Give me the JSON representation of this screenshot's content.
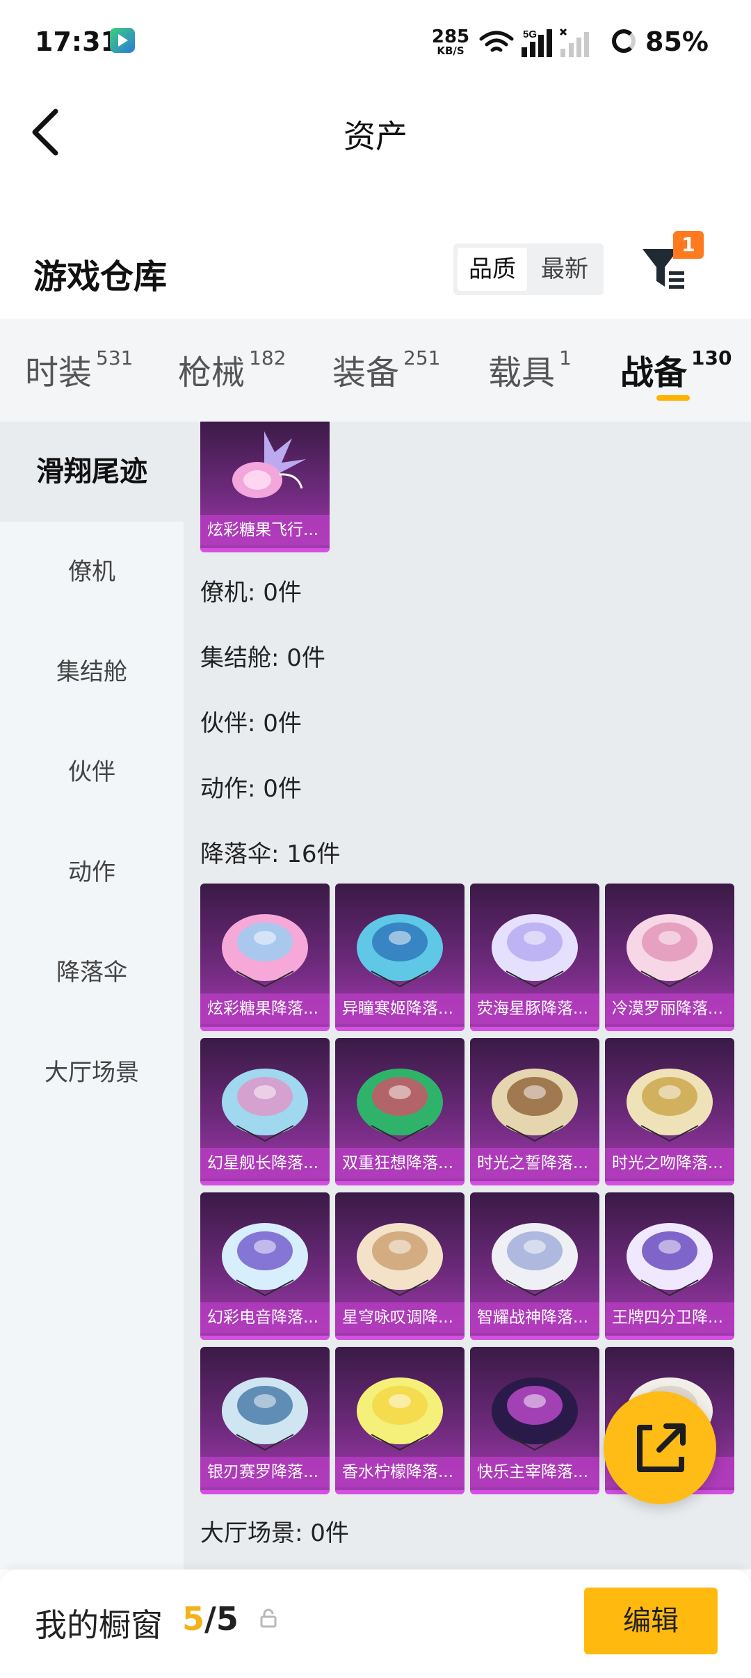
{
  "status_bar": {
    "time": "17:31",
    "net_speed": "285",
    "net_unit": "KB/S",
    "network_type": "5G",
    "battery": "85%"
  },
  "header": {
    "title": "资产"
  },
  "warehouse": {
    "title": "游戏仓库",
    "sort_options": [
      "品质",
      "最新"
    ],
    "filter_badge": "1"
  },
  "tabs": [
    {
      "label": "时装",
      "count": "531"
    },
    {
      "label": "枪械",
      "count": "182"
    },
    {
      "label": "装备",
      "count": "251"
    },
    {
      "label": "载具",
      "count": "1"
    },
    {
      "label": "战备",
      "count": "130"
    }
  ],
  "sidebar": {
    "items": [
      {
        "label": "滑翔尾迹"
      },
      {
        "label": "僚机"
      },
      {
        "label": "集结舱"
      },
      {
        "label": "伙伴"
      },
      {
        "label": "动作"
      },
      {
        "label": "降落伞"
      },
      {
        "label": "大厅场景"
      }
    ]
  },
  "content": {
    "glide_trail_items": [
      {
        "name": "炫彩糖果飞行..."
      }
    ],
    "sections": [
      {
        "label": "僚机: 0件"
      },
      {
        "label": "集结舱: 0件"
      },
      {
        "label": "伙伴: 0件"
      },
      {
        "label": "动作: 0件"
      },
      {
        "label": "降落伞: 16件"
      }
    ],
    "parachutes": [
      {
        "name": "炫彩糖果降落...",
        "c1": "#f6a9d8",
        "c2": "#8fd3f4"
      },
      {
        "name": "异瞳寒姬降落...",
        "c1": "#5ec8e6",
        "c2": "#2c6fb8"
      },
      {
        "name": "荧海星豚降落...",
        "c1": "#e6e0ff",
        "c2": "#b0a6f0"
      },
      {
        "name": "冷漠罗丽降落...",
        "c1": "#f7d6e6",
        "c2": "#e08fb3"
      },
      {
        "name": "幻星舰长降落...",
        "c1": "#9fd8ef",
        "c2": "#e78fc4"
      },
      {
        "name": "双重狂想降落...",
        "c1": "#2fb36a",
        "c2": "#e04a6a"
      },
      {
        "name": "时光之誓降落...",
        "c1": "#e6d6b0",
        "c2": "#8a5a30"
      },
      {
        "name": "时光之吻降落...",
        "c1": "#f0e2b8",
        "c2": "#c8a040"
      },
      {
        "name": "幻彩电音降落...",
        "c1": "#d7eefc",
        "c2": "#6a4cc8"
      },
      {
        "name": "星穹咏叹调降...",
        "c1": "#f3e2c8",
        "c2": "#c99a6a"
      },
      {
        "name": "智耀战神降落...",
        "c1": "#eef0f6",
        "c2": "#9aa6d6"
      },
      {
        "name": "王牌四分卫降...",
        "c1": "#f0e8ff",
        "c2": "#5a3ab8"
      },
      {
        "name": "银刃赛罗降落...",
        "c1": "#cfe6f2",
        "c2": "#3a6fa0"
      },
      {
        "name": "香水柠檬降落...",
        "c1": "#f5f07a",
        "c2": "#f3d640"
      },
      {
        "name": "快乐主宰降落...",
        "c1": "#2a1a4a",
        "c2": "#c94fd8"
      },
      {
        "name": "",
        "c1": "#f2eee8",
        "c2": "#d8cfc4"
      }
    ],
    "lobby_label": "大厅场景: 0件"
  },
  "bottom": {
    "showcase_label": "我的橱窗",
    "showcase_current": "5",
    "showcase_total": "/5",
    "edit_label": "编辑"
  },
  "colors": {
    "accent": "#ffb90f",
    "badge": "#ff7a1f",
    "card_purple": "#a43bb0"
  }
}
